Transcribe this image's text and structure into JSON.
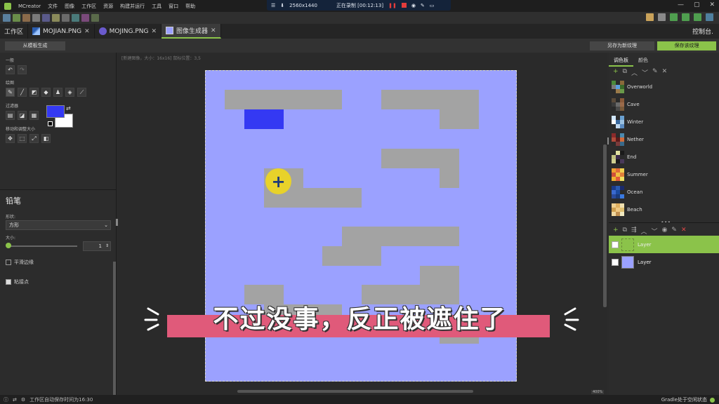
{
  "menu": {
    "app_name": "MCreator",
    "items": [
      "文件",
      "图像",
      "工作区",
      "资源",
      "构建并运行",
      "工具",
      "窗口",
      "帮助"
    ]
  },
  "recording": {
    "resolution": "2560x1440",
    "status": "正在录制 [00:12:13]"
  },
  "tabs": [
    {
      "label": "工作区",
      "icon": "workspace-icon"
    },
    {
      "label": "MOJIAN.PNG",
      "icon": "sword-icon"
    },
    {
      "label": "MOJING.PNG",
      "icon": "orb-icon"
    },
    {
      "label": "图像生成器",
      "icon": "image-icon"
    }
  ],
  "console_label": "控制台.",
  "subbar": {
    "template_button": "从模板生成",
    "save_new_button": "另存为新纹理",
    "save_button": "保存该纹理"
  },
  "left": {
    "general": "一般",
    "drawing": "绘图",
    "filters": "过滤器",
    "move_resize": "移动和调整大小",
    "tool_title": "铅笔",
    "shape_label": "形状:",
    "shape_value": "方形",
    "size_label": "大小:",
    "size_value": "1",
    "smooth_label": "平滑边缘",
    "snap_label": "粘接点",
    "smooth_checked": false,
    "snap_checked": true,
    "primary_color": "#3439f3",
    "secondary_color": "#ffffff"
  },
  "canvas_info": "[新建图像，大小：16x16] 鼠标位置：3,5",
  "canvas_bg": "#9ba1ff",
  "zoom": "400%",
  "right": {
    "tab_palette": "调色板",
    "tab_colors": "颜色",
    "palettes": [
      "Overworld",
      "Cave",
      "Winter",
      "Nether",
      "End",
      "Summer",
      "Ocean",
      "Beach"
    ],
    "layers": [
      "Layer",
      "Layer"
    ],
    "accent": "#8bc34a"
  },
  "status": {
    "autosave": "工作区自动保存时间为16:30",
    "gradle": "Gradle处于空闲状态"
  },
  "subtitle": "不过没事，反正被遮住了"
}
